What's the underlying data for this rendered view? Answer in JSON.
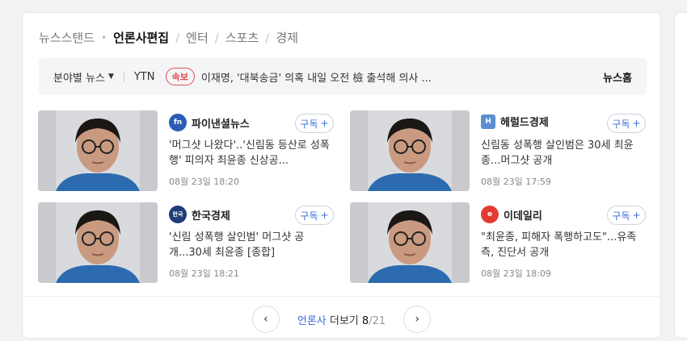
{
  "tabs": {
    "newsstand": "뉴스스탠드",
    "bullet": "•",
    "press_edit": "언론사편집",
    "ent": "엔터",
    "sports": "스포츠",
    "economy": "경제",
    "slash": "/"
  },
  "ticker": {
    "category": "분야별 뉴스",
    "caret": "▼",
    "source": "YTN",
    "dot": "·",
    "badge": "속보",
    "headline": "이재명, '대북송금' 의혹 내일 오전 檢 출석해 의사 ...",
    "more": "뉴스홈"
  },
  "articles": [
    {
      "press": "파이낸셜뉴스",
      "logo_text": "fn",
      "logo_color": "#2b5bb5",
      "subscribe": "구독",
      "plus": "+",
      "title": "'머그샷 나왔다'..'신림동 등산로 성폭행' 피의자 최윤종 신상공...",
      "date": "08월 23일 18:20"
    },
    {
      "press": "헤럴드경제",
      "logo_text": "H",
      "logo_color": "#5b8fd1",
      "subscribe": "구독",
      "plus": "+",
      "title": "신림동 성폭행 살인범은 30세 최윤종...머그샷 공개",
      "date": "08월 23일 17:59"
    },
    {
      "press": "한국경제",
      "logo_text": "한국",
      "logo_color": "#1f3c78",
      "subscribe": "구독",
      "plus": "+",
      "title": "'신림 성폭행 살인범' 머그샷 공개...30세 최윤종 [종합]",
      "date": "08월 23일 18:21"
    },
    {
      "press": "이데일리",
      "logo_text": "e",
      "logo_color": "#e23b33",
      "subscribe": "구독",
      "plus": "+",
      "title": "\"최윤종, 피해자 폭행하고도\"...유족 측, 진단서 공개",
      "date": "08월 23일 18:09"
    }
  ],
  "pager": {
    "prev": "‹",
    "next": "›",
    "link": "언론사",
    "label": "더보기",
    "current": "8",
    "total": "/21"
  }
}
